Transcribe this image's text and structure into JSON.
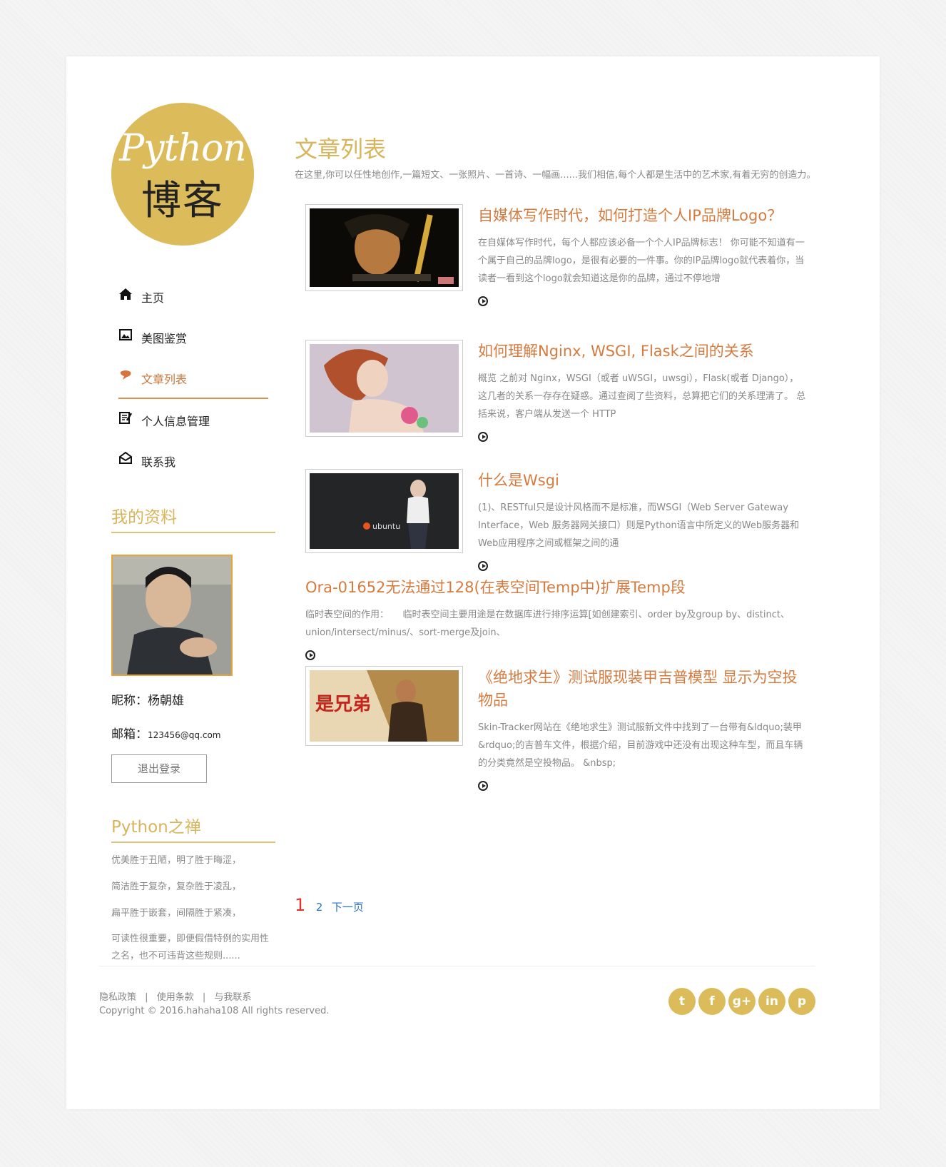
{
  "logo": {
    "script": "Python",
    "cn": "博客"
  },
  "nav": [
    {
      "label": "主页",
      "icon": "home-icon",
      "active": false
    },
    {
      "label": "美图鉴赏",
      "icon": "picture-icon",
      "active": false
    },
    {
      "label": "文章列表",
      "icon": "chat-icon",
      "active": true
    },
    {
      "label": "个人信息管理",
      "icon": "edit-icon",
      "active": false
    },
    {
      "label": "联系我",
      "icon": "envelope-icon",
      "active": false
    }
  ],
  "profile": {
    "heading": "我的资料",
    "nickname_label": "昵称：",
    "nickname": "杨朝雄",
    "email_label": "邮箱：",
    "email": "123456@qq.com",
    "logout": "退出登录"
  },
  "zen": {
    "heading": "Python之禅",
    "lines": [
      "优美胜于丑陋，明了胜于晦涩，",
      "简洁胜于复杂，复杂胜于凌乱，",
      "扁平胜于嵌套，间隔胜于紧凑，",
      "可读性很重要，即便假借特例的实用性之名，也不可违背这些规则......"
    ]
  },
  "main": {
    "title": "文章列表",
    "intro": "在这里,你可以任性地创作,一篇短文、一张照片、一首诗、一幅画......我们相信,每个人都是生活中的艺术家,有着无穷的创造力。"
  },
  "posts": [
    {
      "title": "自媒体写作时代，如何打造个人IP品牌Logo？",
      "excerpt": "在自媒体写作时代，每个人都应该必备一个个人IP品牌标志！ 你可能不知道有一个属于自己的品牌logo，是很有必要的一件事。你的IP品牌logo就代表着你，当读者一看到这个logo就会知道这是你的品牌，通过不停地增",
      "has_image": true
    },
    {
      "title": "如何理解Nginx, WSGI, Flask之间的关系",
      "excerpt": "概览 之前对 Nginx，WSGI（或者 uWSGI，uwsgi），Flask(或者 Django），这几者的关系一存存在疑惑。通过查阅了些资料，总算把它们的关系理清了。 总括来说，客户端从发送一个 HTTP",
      "has_image": true
    },
    {
      "title": "什么是Wsgi",
      "excerpt": "(1)、RESTful只是设计风格而不是标准，而WSGI（Web Server Gateway Interface，Web 服务器网关接口）则是Python语言中所定义的Web服务器和Web应用程序之间或框架之间的通",
      "has_image": true,
      "image_text": "ubuntu"
    },
    {
      "title": "Ora-01652无法通过128(在表空间Temp中)扩展Temp段",
      "excerpt": "临时表空间的作用：　　临时表空间主要用途是在数据库进行排序运算[如创建索引、order by及group by、distinct、union/intersect/minus/、sort-merge及join、",
      "has_image": false
    },
    {
      "title": "《绝地求生》测试服现装甲吉普模型 显示为空投物品",
      "excerpt": "Skin-Tracker网站在《绝地求生》测试服新文件中找到了一台带有&ldquo;装甲&rdquo;的吉普车文件，根据介绍，目前游戏中还没有出现这种车型，而且车辆的分类竟然是空投物品。 &nbsp;",
      "has_image": true,
      "image_text": "是兄弟"
    }
  ],
  "pager": {
    "current": "1",
    "page2": "2",
    "next": "下一页"
  },
  "footer": {
    "links": [
      "隐私政策",
      "使用条款",
      "与我联系"
    ],
    "sep": "|",
    "copyright": "Copyright © 2016.hahaha108 All rights reserved.",
    "social": [
      {
        "icon": "twitter-icon",
        "glyph": "t"
      },
      {
        "icon": "facebook-icon",
        "glyph": "f"
      },
      {
        "icon": "googleplus-icon",
        "glyph": "g+"
      },
      {
        "icon": "linkedin-icon",
        "glyph": "in"
      },
      {
        "icon": "pinterest-icon",
        "glyph": "p"
      }
    ]
  },
  "colors": {
    "accent_gold": "#dcbb5b",
    "post_title": "#d57b3f",
    "active_nav": "#c8783c",
    "pager_current": "#e2322b",
    "pager_link": "#2a73c8"
  }
}
